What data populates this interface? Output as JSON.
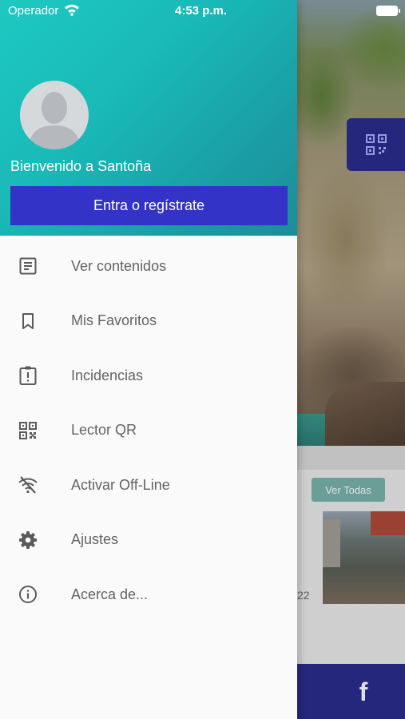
{
  "status_bar": {
    "carrier": "Operador",
    "time": "4:53 p.m."
  },
  "drawer": {
    "welcome_text": "Bienvenido a Santoña",
    "login_button": "Entra o regístrate",
    "menu_items": [
      {
        "label": "Ver contenidos",
        "icon": "list-document-icon"
      },
      {
        "label": "Mis Favoritos",
        "icon": "bookmark-icon"
      },
      {
        "label": "Incidencias",
        "icon": "alert-clipboard-icon"
      },
      {
        "label": "Lector QR",
        "icon": "qr-code-icon"
      },
      {
        "label": "Activar Off-Line",
        "icon": "wifi-off-icon"
      },
      {
        "label": "Ajustes",
        "icon": "gear-icon"
      },
      {
        "label": "Acerca de...",
        "icon": "info-icon"
      }
    ]
  },
  "background": {
    "see_all_button": "Ver Todas",
    "date_fragment": "22",
    "social_icon": "f"
  },
  "colors": {
    "header_gradient_start": "#1ec9c2",
    "header_gradient_end": "#1c8d98",
    "primary_button": "#3433c8",
    "footer": "#2b2d8f",
    "menu_text": "#636363",
    "menu_icon": "#5a5a5a"
  }
}
